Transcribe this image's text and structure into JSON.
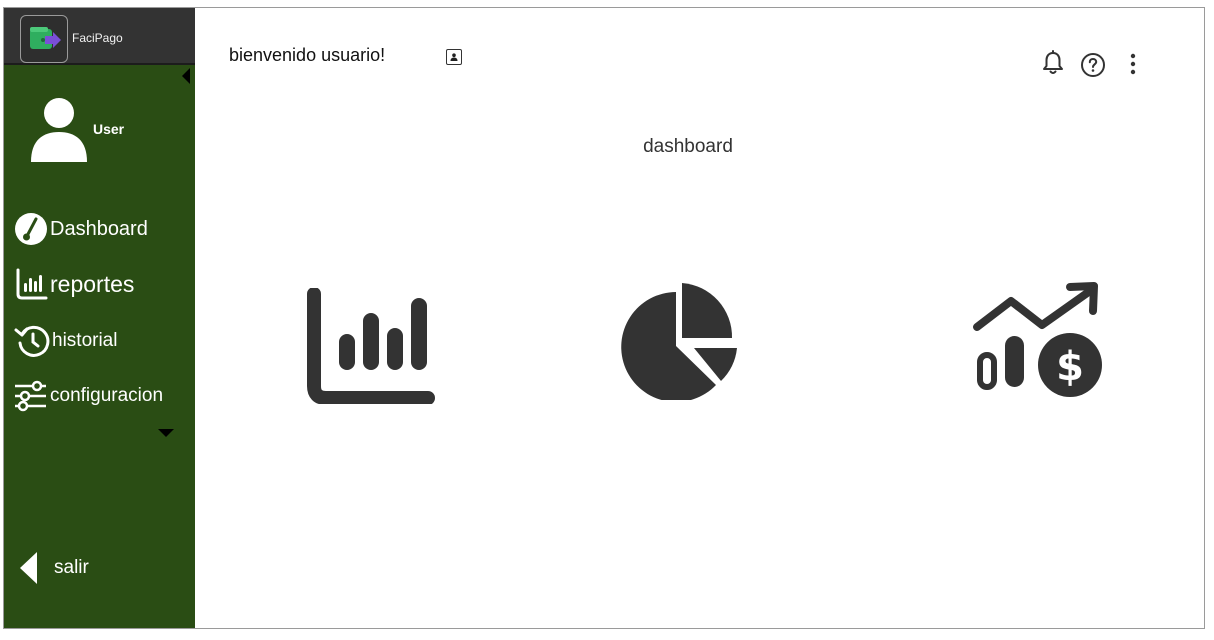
{
  "app": {
    "name": "FaciPago"
  },
  "sidebar": {
    "user": {
      "name": "User"
    },
    "items": [
      {
        "label": "Dashboard",
        "icon": "gauge-icon"
      },
      {
        "label": "reportes",
        "icon": "bar-chart-icon"
      },
      {
        "label": "historial",
        "icon": "history-icon"
      },
      {
        "label": "configuracion",
        "icon": "sliders-icon"
      }
    ],
    "logout": {
      "label": "salir"
    }
  },
  "header": {
    "welcome": "bienvenido usuario!",
    "icons": [
      "bell-icon",
      "help-icon",
      "more-vertical-icon"
    ]
  },
  "main": {
    "title": "dashboard",
    "cards": [
      {
        "icon": "bar-chart-icon"
      },
      {
        "icon": "pie-chart-icon"
      },
      {
        "icon": "money-growth-icon"
      }
    ]
  },
  "colors": {
    "sidebar_bg": "#2a4d14",
    "brand_bar_bg": "#333333",
    "icon_dark": "#333333"
  }
}
